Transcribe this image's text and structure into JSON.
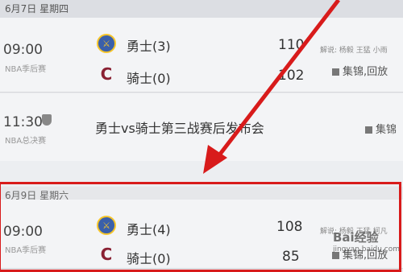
{
  "sections": [
    {
      "date": "6月7日 星期四",
      "rows": [
        {
          "time": "09:00",
          "league": "NBA季后赛",
          "team1": "勇士(3)",
          "score1": "110",
          "team2": "骑士(0)",
          "score2": "102",
          "extra": "解说: 杨毅 王猛 小雨",
          "action": "集锦,回放"
        },
        {
          "time": "11:30",
          "league": "NBA总决赛",
          "title": "勇士vs骑士第三战赛后发布会",
          "action": "集锦"
        }
      ]
    },
    {
      "date": "6月9日 星期六",
      "rows": [
        {
          "time": "09:00",
          "league": "NBA季后赛",
          "team1": "勇士(4)",
          "score1": "108",
          "team2": "骑士(0)",
          "score2": "85",
          "extra": "解说: 杨毅 王猛 柯凡",
          "action": "集锦,回放"
        }
      ]
    }
  ],
  "watermark": {
    "text": "Bai经验",
    "sub": "jingyan.baidu.com"
  },
  "annotation": {
    "color": "#d81b1b"
  }
}
